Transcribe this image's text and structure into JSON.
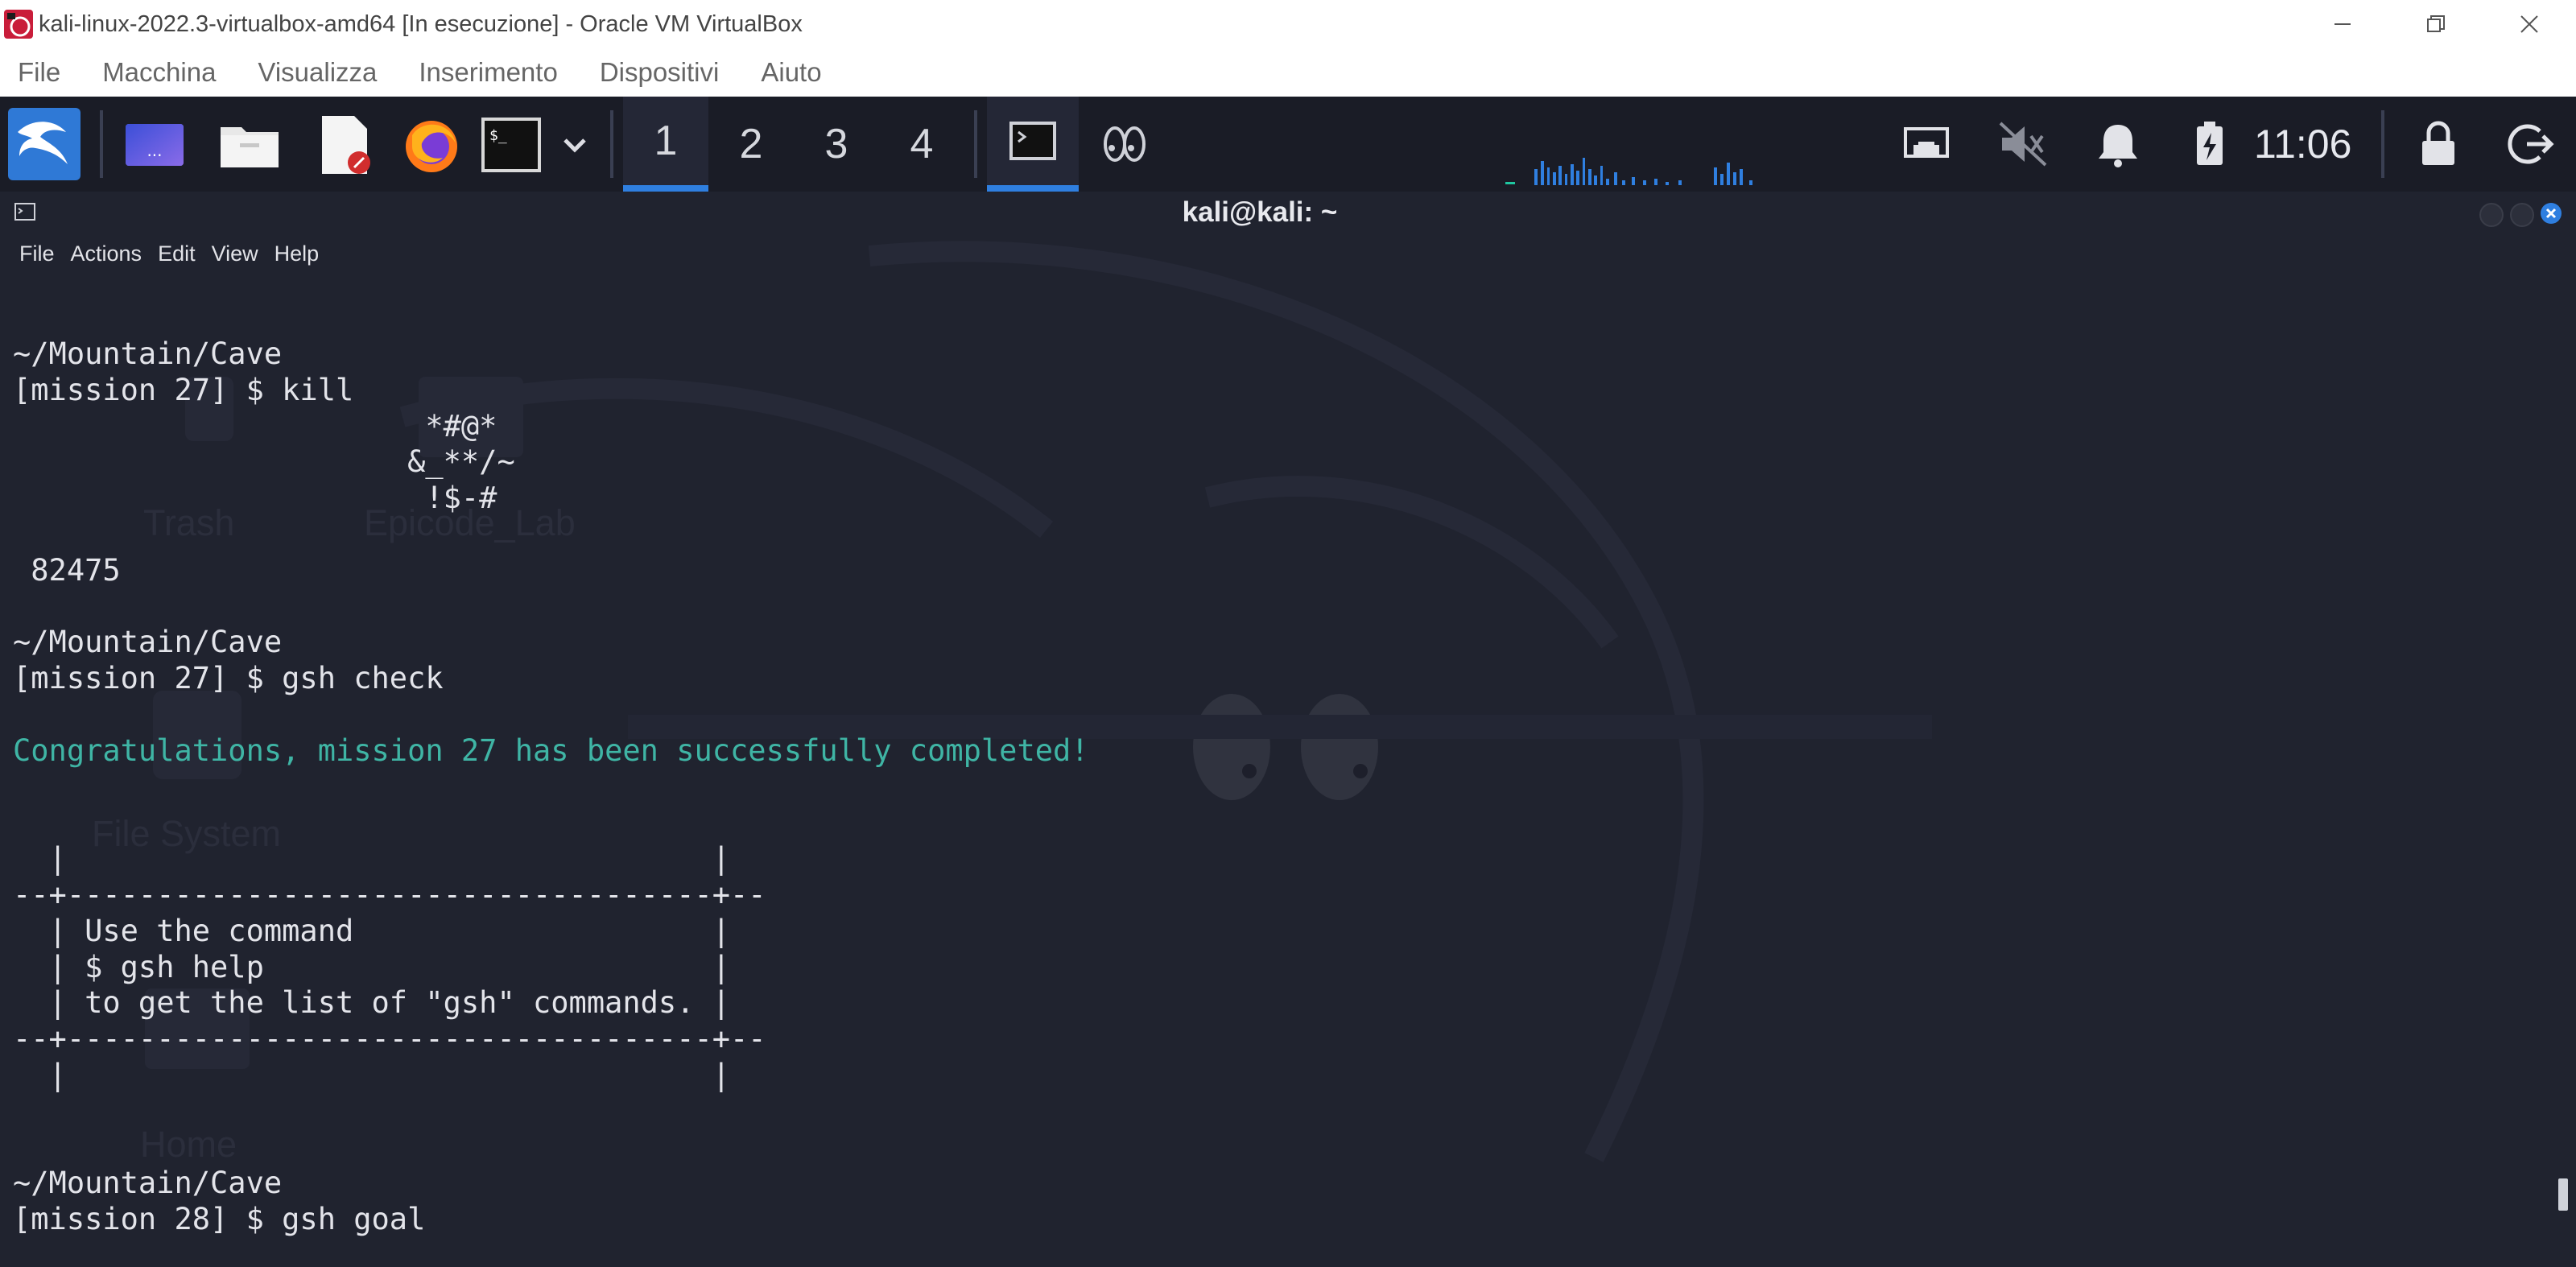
{
  "host": {
    "title": "kali-linux-2022.3-virtualbox-amd64 [In esecuzione] - Oracle VM VirtualBox",
    "menu": [
      "File",
      "Macchina",
      "Visualizza",
      "Inserimento",
      "Dispositivi",
      "Aiuto"
    ],
    "controls": [
      "minimize-icon",
      "restore-icon",
      "close-icon"
    ]
  },
  "panel": {
    "launchers": [
      "kali-menu-icon",
      "show-desktop-icon",
      "file-manager-icon",
      "text-editor-icon",
      "firefox-icon",
      "terminal-icon",
      "chevron-down-icon"
    ],
    "workspaces": [
      "1",
      "2",
      "3",
      "4"
    ],
    "active_workspace": "1",
    "tasks": [
      "terminal-task-icon",
      "eyes-task-icon"
    ],
    "tray": [
      "network-icon",
      "volume-muted-icon",
      "notifications-icon",
      "battery-charging-icon"
    ],
    "clock": "11:06",
    "actions": [
      "lock-icon",
      "logout-icon"
    ],
    "accent": "#2f7fe0"
  },
  "terminal": {
    "title": "kali@kali: ~",
    "menu": [
      "File",
      "Actions",
      "Edit",
      "View",
      "Help"
    ],
    "desktop_labels": [
      "Trash",
      "Epicode_Lab",
      "File System",
      "Home"
    ],
    "lines": [
      {
        "text": "~/Mountain/Cave",
        "style": "normal"
      },
      {
        "text": "[mission 27] $ kill",
        "style": "normal"
      },
      {
        "text": "                       *#@*",
        "style": "normal"
      },
      {
        "text": "                      &_**/~",
        "style": "normal"
      },
      {
        "text": "                       !$-#",
        "style": "normal"
      },
      {
        "text": "",
        "style": "normal"
      },
      {
        "text": " 82475",
        "style": "normal"
      },
      {
        "text": "",
        "style": "normal"
      },
      {
        "text": "~/Mountain/Cave",
        "style": "normal"
      },
      {
        "text": "[mission 27] $ gsh check",
        "style": "normal"
      },
      {
        "text": "",
        "style": "normal"
      },
      {
        "text": "Congratulations, mission 27 has been successfully completed!",
        "style": "success"
      },
      {
        "text": "",
        "style": "normal"
      },
      {
        "text": "",
        "style": "normal"
      },
      {
        "text": "  |                                    |",
        "style": "normal"
      },
      {
        "text": "--+------------------------------------+--",
        "style": "normal"
      },
      {
        "text": "  | Use the command                    |",
        "style": "normal"
      },
      {
        "text": "  | $ gsh help                         |",
        "style": "normal"
      },
      {
        "text": "  | to get the list of \"gsh\" commands. |",
        "style": "normal"
      },
      {
        "text": "--+------------------------------------+--",
        "style": "normal"
      },
      {
        "text": "  |                                    |",
        "style": "normal"
      },
      {
        "text": "",
        "style": "normal"
      },
      {
        "text": "",
        "style": "normal"
      },
      {
        "text": "~/Mountain/Cave",
        "style": "normal"
      },
      {
        "text": "[mission 28] $ gsh goal",
        "style": "normal"
      }
    ],
    "success_color": "#3fb5a5"
  }
}
